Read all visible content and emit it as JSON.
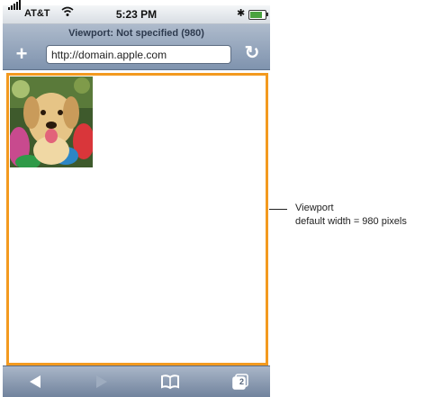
{
  "status_bar": {
    "carrier": "AT&T",
    "time": "5:23 PM",
    "bluetooth": "✱"
  },
  "navbar": {
    "title": "Viewport: Not specified (980)",
    "add_label": "+",
    "url": "http://domain.apple.com",
    "reload_label": "↻"
  },
  "content": {
    "image": "dog photo"
  },
  "toolbar": {
    "back": "back-icon",
    "forward": "forward-icon",
    "bookmarks": "bookmarks-icon",
    "pages": "pages-icon",
    "pages_count": "2"
  },
  "annotation": {
    "line1": "Viewport",
    "line2": "default width = 980 pixels"
  },
  "colors": {
    "viewport_border": "#f39a1f",
    "toolbar": "#7f93ae"
  }
}
